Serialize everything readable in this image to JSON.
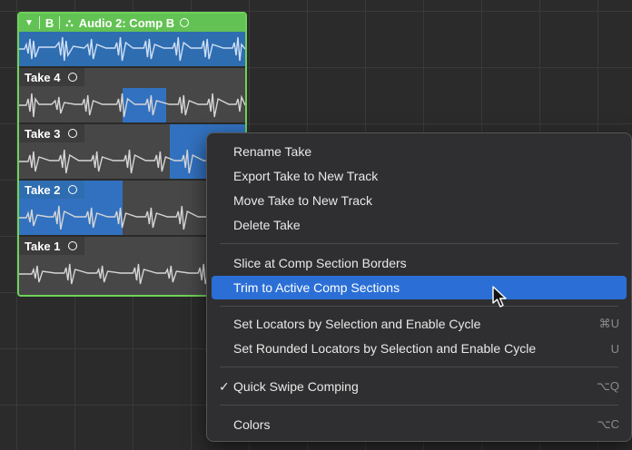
{
  "folder": {
    "header_glyph_disclosure": "▼",
    "header_badge": "B",
    "header_glyph_quick_swipe": "⛬",
    "title": "Audio 2: Comp B"
  },
  "takes": [
    {
      "label": "Take 4"
    },
    {
      "label": "Take 3"
    },
    {
      "label": "Take 2"
    },
    {
      "label": "Take 1"
    }
  ],
  "context_menu": {
    "rename_take": "Rename Take",
    "export_take": "Export Take to New Track",
    "move_take": "Move Take to New Track",
    "delete_take": "Delete Take",
    "slice_at_borders": "Slice at Comp Section Borders",
    "trim_to_active": "Trim to Active Comp Sections",
    "set_locators": "Set Locators by Selection and Enable Cycle",
    "set_locators_shortcut": "⌘U",
    "set_rounded_locators": "Set Rounded Locators by Selection and Enable Cycle",
    "set_rounded_locators_shortcut": "U",
    "quick_swipe_check": "✓",
    "quick_swipe": "Quick Swipe Comping",
    "quick_swipe_shortcut": "⌥Q",
    "colors": "Colors",
    "colors_shortcut": "⌥C"
  },
  "colors": {
    "folder_green": "#63c254",
    "selection_blue": "#3271bf",
    "menu_highlight": "#2b6fd6"
  }
}
